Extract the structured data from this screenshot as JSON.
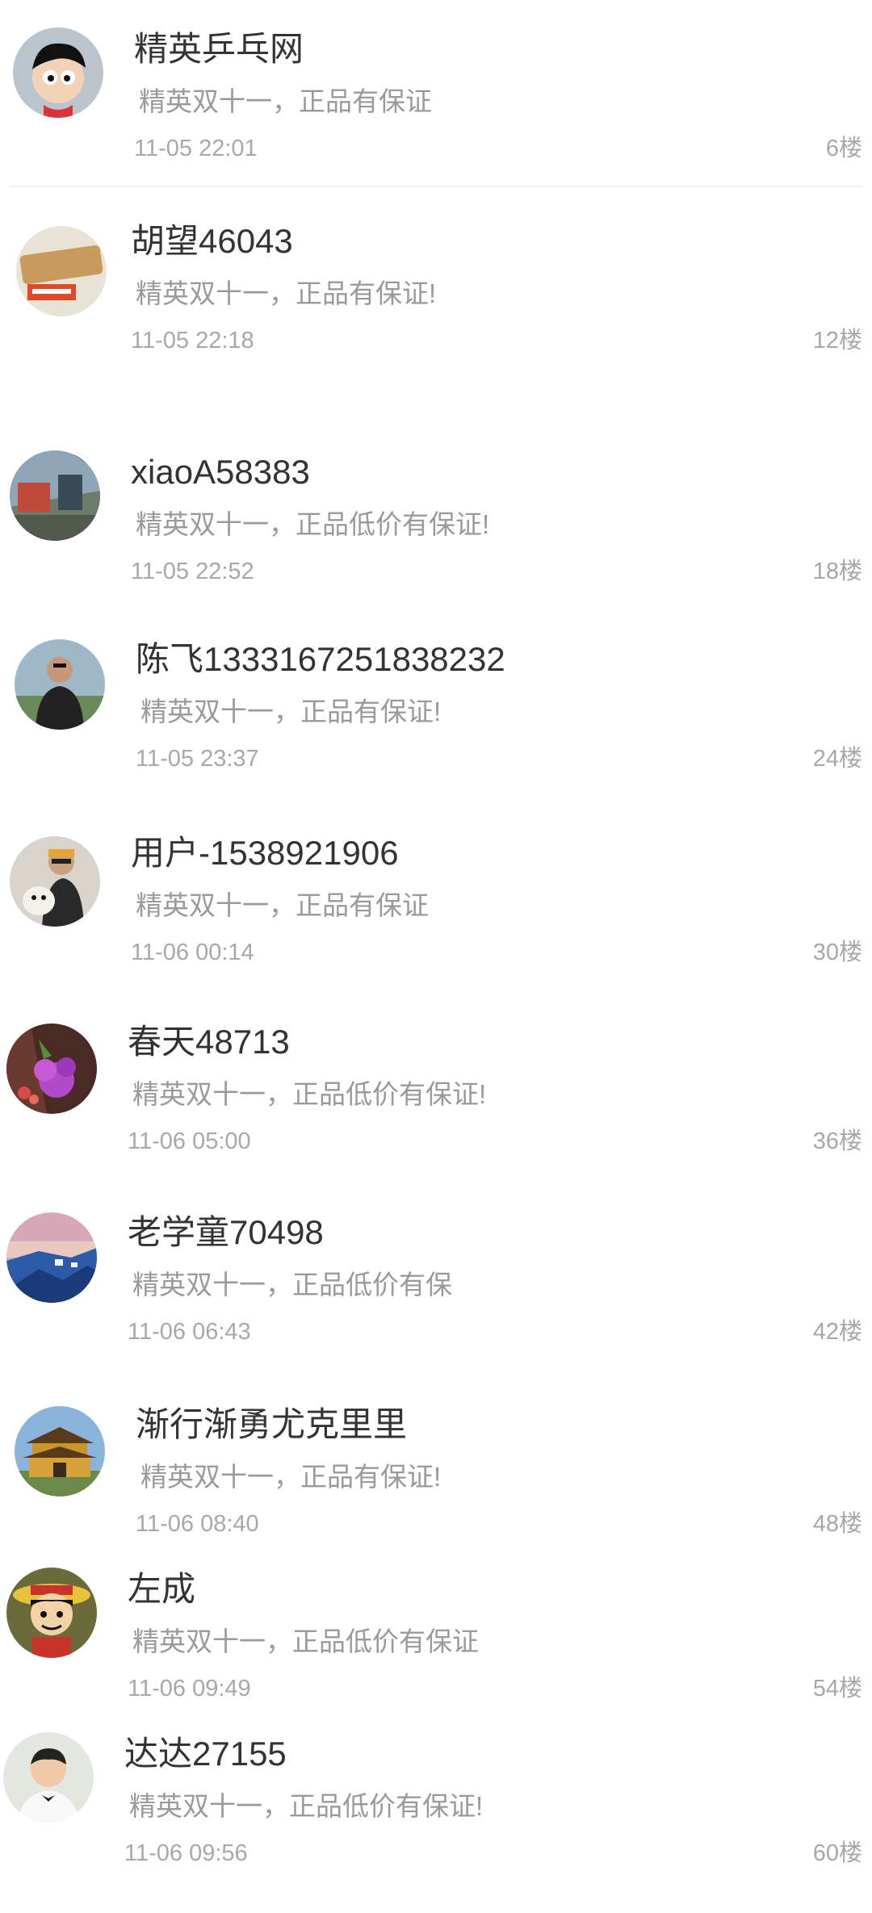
{
  "comments": [
    {
      "name": "精英乒乓网",
      "content": "精英双十一，正品有保证",
      "time": "11-05 22:01",
      "floor": "6楼",
      "avatar": "cartoon-boy-avatar"
    },
    {
      "name": "胡望46043",
      "content": "精英双十一，正品有保证!",
      "time": "11-05 22:18",
      "floor": "12楼",
      "avatar": "wood-sign-avatar"
    },
    {
      "name": "xiaoA58383",
      "content": "精英双十一，正品低价有保证!",
      "time": "11-05 22:52",
      "floor": "18楼",
      "avatar": "street-scene-avatar"
    },
    {
      "name": "陈飞1333167251838232",
      "content": "精英双十一，正品有保证!",
      "time": "11-05 23:37",
      "floor": "24楼",
      "avatar": "man-portrait-avatar"
    },
    {
      "name": "用户-1538921906",
      "content": "精英双十一，正品有保证",
      "time": "11-06 00:14",
      "floor": "30楼",
      "avatar": "selfie-dog-avatar"
    },
    {
      "name": "春天48713",
      "content": "精英双十一，正品低价有保证!",
      "time": "11-06 05:00",
      "floor": "36楼",
      "avatar": "purple-flower-avatar"
    },
    {
      "name": "老学童70498",
      "content": "精英双十一，正品低价有保",
      "time": "11-06 06:43",
      "floor": "42楼",
      "avatar": "coastal-town-avatar"
    },
    {
      "name": "渐行渐勇尤克里里",
      "content": "精英双十一，正品有保证!",
      "time": "11-06 08:40",
      "floor": "48楼",
      "avatar": "temple-avatar"
    },
    {
      "name": "左成",
      "content": "精英双十一，正品低价有保证",
      "time": "11-06 09:49",
      "floor": "54楼",
      "avatar": "straw-hat-cartoon-avatar"
    },
    {
      "name": "达达27155",
      "content": "精英双十一，正品低价有保证!",
      "time": "11-06 09:56",
      "floor": "60楼",
      "avatar": "young-man-portrait-avatar"
    }
  ]
}
